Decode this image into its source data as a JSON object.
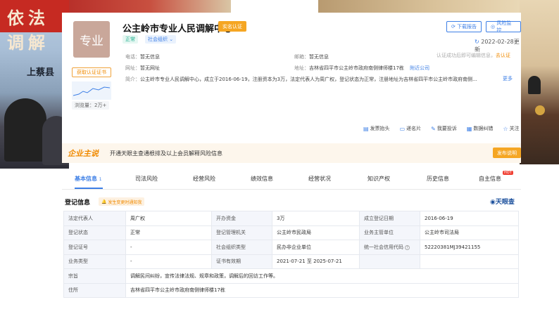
{
  "photo": {
    "banner_text": "依法调解",
    "county_text": "上蔡县"
  },
  "company": {
    "logo_text": "专业",
    "name": "公主岭市专业人民调解中心",
    "verified_badge": "实名认证",
    "status": "正常",
    "org_type": "社会组织",
    "cert_link": "获取认证证书",
    "views": "浏览量：2万+",
    "updated": "2022-02-28更新"
  },
  "toolbar": {
    "download_report": "下载报告",
    "risk_monitor": "风险监控"
  },
  "contact": {
    "phone_label": "电话：",
    "phone_value": "暂无信息",
    "email_label": "邮箱：",
    "email_value": "暂无信息",
    "website_label": "网址：",
    "website_value": "暂无网址",
    "address_label": "地址：",
    "address_value": "吉林省四平市公主岭市政府南侧律师楼17栋",
    "nearby_link": "附近公司",
    "intro_label": "简介：",
    "intro_value": "公主岭市专业人民调解中心，成立于2016-06-19，注册资本为3万，法定代表人为周广权，登记状态为正常，注册地址为吉林省四平市公主岭市政府南侧...",
    "more_link": "更多",
    "hint_text": "认证成功后即可编辑信息，",
    "hint_link": "去认证"
  },
  "actions": [
    "发票抬头",
    "递名片",
    "我要投诉",
    "数据纠错",
    "关注"
  ],
  "owner": {
    "title": "企业主说",
    "text": "开通天眼主查通根排及以上会员解释风险信息",
    "button": "发布说明"
  },
  "tabs": [
    {
      "label": "基本信息",
      "count": "1"
    },
    {
      "label": "司法风险"
    },
    {
      "label": "经营风险"
    },
    {
      "label": "绩效信息"
    },
    {
      "label": "经营状况"
    },
    {
      "label": "知识产权"
    },
    {
      "label": "历史信息"
    },
    {
      "label": "自主信息",
      "hot": "HOT"
    }
  ],
  "registration": {
    "title": "登记信息",
    "tag": "发生变更时通知我",
    "brand": "天眼查",
    "rows": [
      [
        "法定代表人",
        "周广权",
        "开办资金",
        "3万",
        "成立登记日期",
        "2016-06-19"
      ],
      [
        "登记状态",
        "正常",
        "登记管理机关",
        "公主岭市民政局",
        "业务主管单位",
        "公主岭市司法局"
      ],
      [
        "登记证号",
        "-",
        "社会组织类型",
        "民办非企业单位",
        "统一社会信用代码",
        "52220381MJ39421155"
      ],
      [
        "业务类型",
        "-",
        "证书有效期",
        "2021-07-21 至 2025-07-21",
        "",
        ""
      ]
    ],
    "scope_label": "宗旨",
    "scope_value": "调解民间纠纷，宣传法律法规、规章和政策，调解后的回访工作等。",
    "address_label": "住所",
    "address_value": "吉林省四平市公主岭市政府南侧律师楼17栋"
  },
  "colors": {
    "accent": "#3d7fe6",
    "orange": "#f5a623",
    "green": "#1aad8c"
  }
}
